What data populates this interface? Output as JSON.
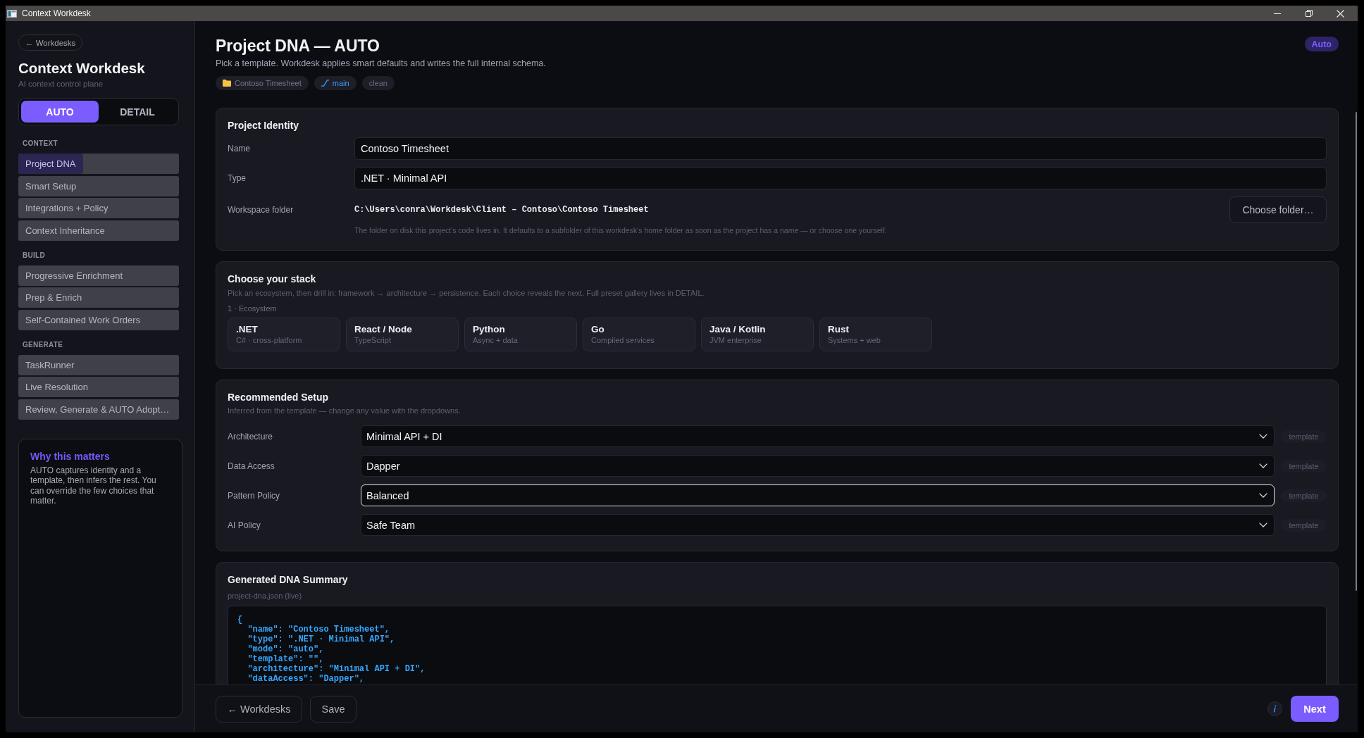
{
  "window": {
    "title": "Context Workdesk"
  },
  "sidebar": {
    "back_button": "← Workdesks",
    "title": "Context Workdesk",
    "subtitle": "AI context control plane",
    "mode_toggle": [
      {
        "label": "AUTO",
        "selected": true
      },
      {
        "label": "DETAIL",
        "selected": false
      }
    ],
    "sections": [
      {
        "heading": "CONTEXT",
        "items": [
          {
            "label": "Project DNA",
            "selected": true
          },
          {
            "label": "Smart Setup",
            "selected": false
          },
          {
            "label": "Integrations + Policy",
            "selected": false
          },
          {
            "label": "Context Inheritance",
            "selected": false
          }
        ]
      },
      {
        "heading": "BUILD",
        "items": [
          {
            "label": "Progressive Enrichment",
            "selected": false
          },
          {
            "label": "Prep & Enrich",
            "selected": false
          },
          {
            "label": "Self-Contained Work Orders",
            "selected": false
          }
        ]
      },
      {
        "heading": "GENERATE",
        "items": [
          {
            "label": "TaskRunner",
            "selected": false
          },
          {
            "label": "Live Resolution",
            "selected": false
          },
          {
            "label": "Review, Generate & AUTO Adopt…",
            "selected": false
          }
        ]
      }
    ],
    "info_card": {
      "title": "Why this matters",
      "body": "AUTO captures identity and a template, then infers the rest. You can override the few choices that matter."
    }
  },
  "header": {
    "title": "Project DNA — AUTO",
    "subtitle": "Pick a template. Workdesk applies smart defaults and writes the full internal schema.",
    "tags": [
      {
        "kind": "folder",
        "label": "Contoso Timesheet"
      },
      {
        "kind": "branch",
        "label": "main"
      },
      {
        "kind": "status",
        "label": "clean"
      }
    ],
    "mode_badge": "Auto"
  },
  "project_identity": {
    "title": "Project Identity",
    "fields": [
      {
        "label": "Name",
        "value": "Contoso Timesheet"
      },
      {
        "label": "Type",
        "value": ".NET · Minimal API"
      }
    ],
    "workspace_folder": {
      "label": "Workspace folder",
      "path": "C:\\Users\\conra\\Workdesk\\Client – Contoso\\Contoso Timesheet",
      "button": "Choose folder…",
      "help": "The folder on disk this project's code lives in. It defaults to a subfolder of this workdesk's home folder as soon as the project has a name — or choose one yourself."
    }
  },
  "stack": {
    "title": "Choose your stack",
    "subtitle": "Pick an ecosystem, then drill in: framework → architecture → persistence. Each choice reveals the next. Full preset gallery lives in DETAIL.",
    "step_label": "1 · Ecosystem",
    "options": [
      {
        "name": ".NET",
        "description": "C# · cross-platform",
        "selected": false
      },
      {
        "name": "React / Node",
        "description": "TypeScript",
        "selected": false
      },
      {
        "name": "Python",
        "description": "Async + data",
        "selected": false
      },
      {
        "name": "Go",
        "description": "Compiled services",
        "selected": false
      },
      {
        "name": "Java / Kotlin",
        "description": "JVM enterprise",
        "selected": false
      },
      {
        "name": "Rust",
        "description": "Systems + web",
        "selected": false
      }
    ]
  },
  "recommended_setup": {
    "title": "Recommended Setup",
    "subtitle": "Inferred from the template — change any value with the dropdowns.",
    "rows": [
      {
        "label": "Architecture",
        "value": "Minimal API + DI",
        "source": "template",
        "focused": false
      },
      {
        "label": "Data Access",
        "value": "Dapper",
        "source": "template",
        "focused": false
      },
      {
        "label": "Pattern Policy",
        "value": "Balanced",
        "source": "template",
        "focused": true
      },
      {
        "label": "AI Policy",
        "value": "Safe Team",
        "source": "template",
        "focused": false
      }
    ]
  },
  "dna_summary": {
    "title": "Generated DNA Summary",
    "file_label": "project-dna.json (live)",
    "code_lines": [
      "{",
      "  \"name\": \"Contoso Timesheet\",",
      "  \"type\": \".NET · Minimal API\",",
      "  \"mode\": \"auto\",",
      "  \"template\": \"\",",
      "  \"architecture\": \"Minimal API + DI\",",
      "  \"dataAccess\": \"Dapper\","
    ]
  },
  "footer": {
    "back_button": "← Workdesks",
    "save_button": "Save",
    "next_button": "Next"
  }
}
